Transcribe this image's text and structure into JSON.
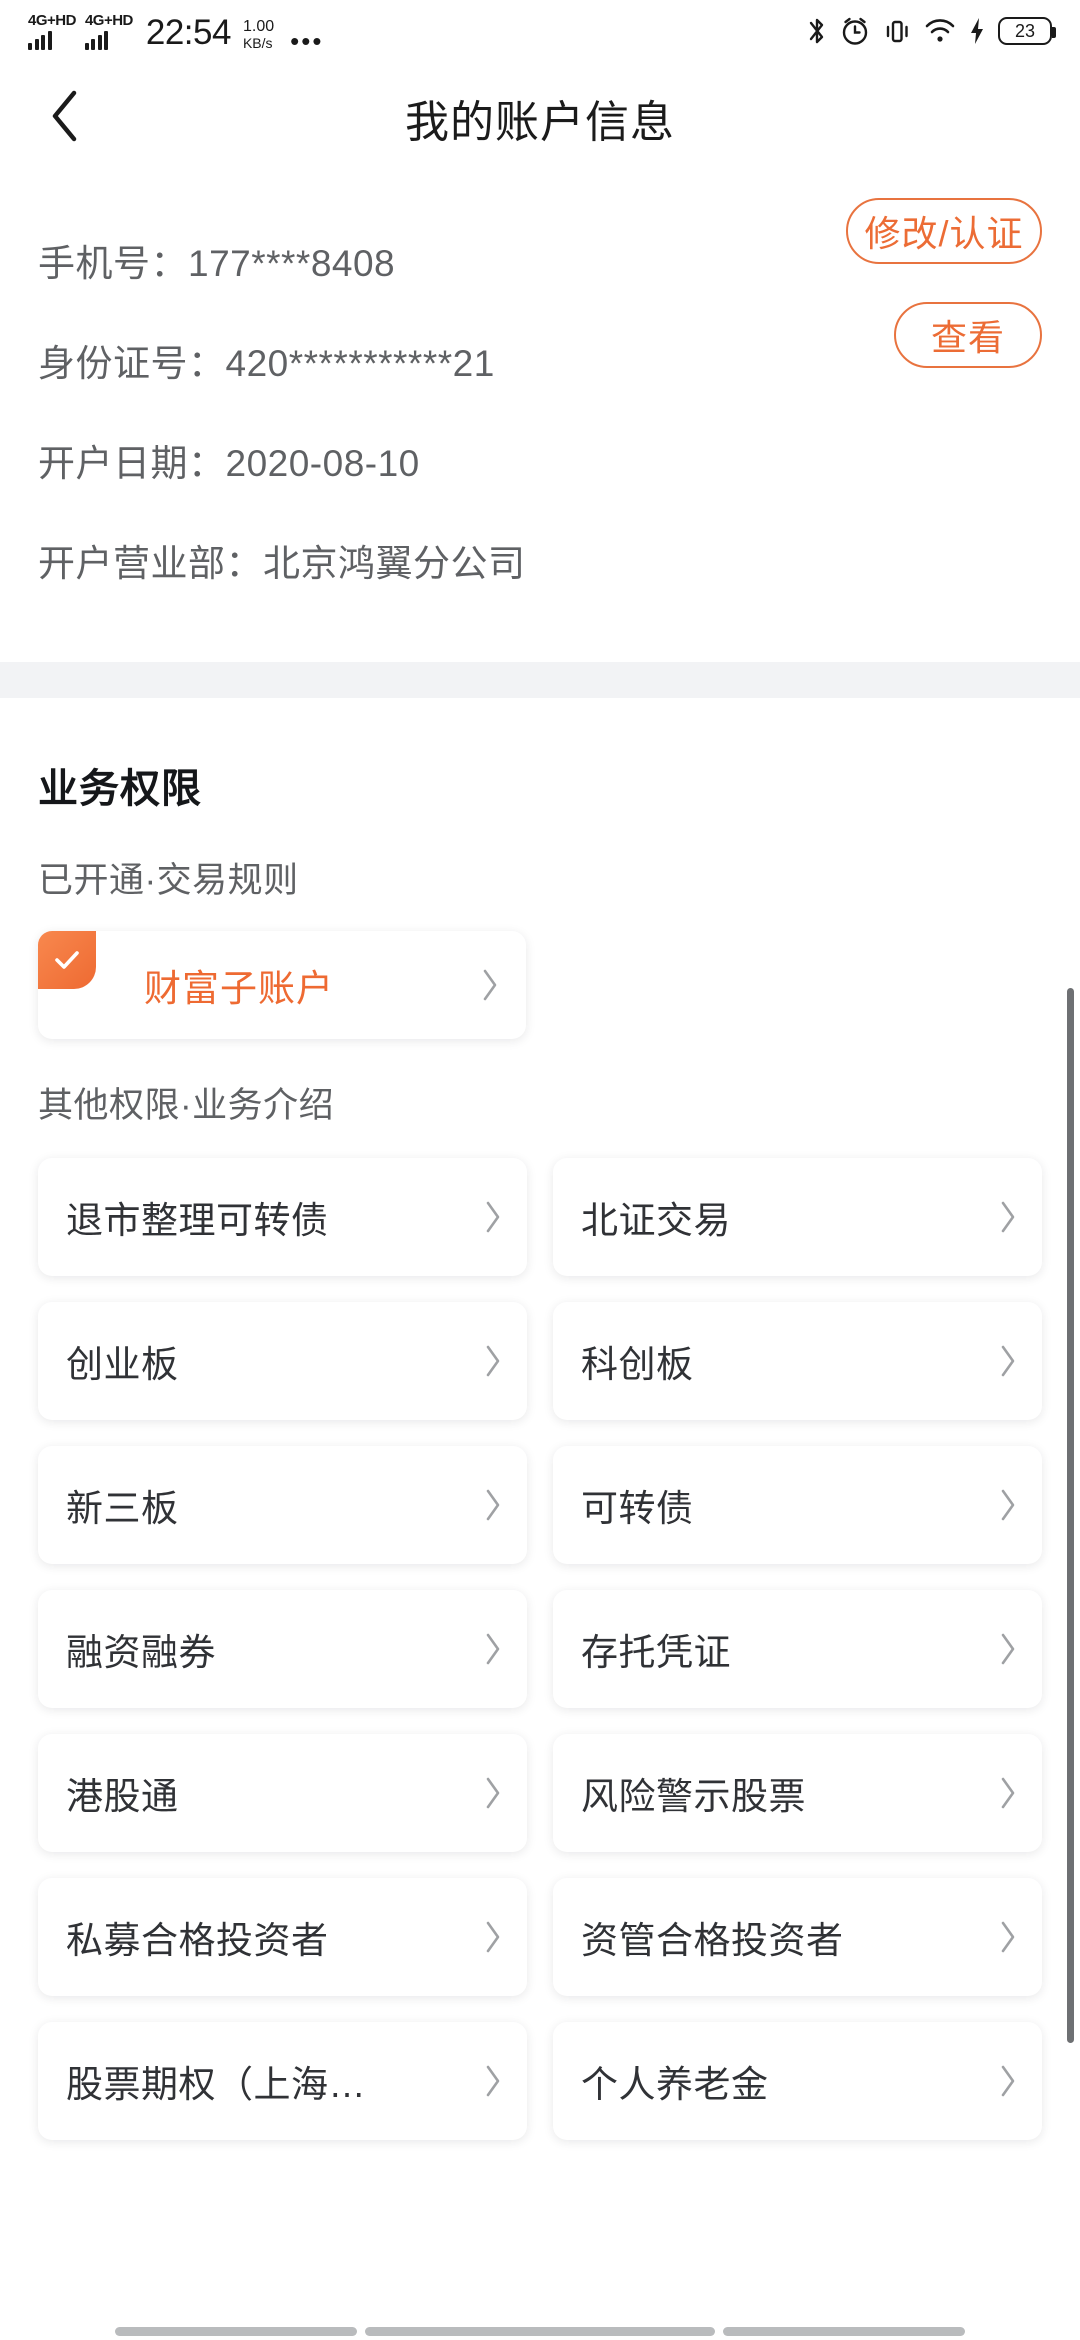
{
  "status_bar": {
    "network_label_1": "4G+HD",
    "network_label_2": "4G+HD",
    "time": "22:54",
    "speed_value": "1.00",
    "speed_unit": "KB/s",
    "more_dots": "•••",
    "battery_level": "23",
    "icons": [
      "bluetooth-icon",
      "alarm-icon",
      "vibrate-icon",
      "wifi-icon",
      "charging-bolt-icon",
      "battery-icon"
    ]
  },
  "nav": {
    "back_icon": "chevron-left-icon",
    "title": "我的账户信息"
  },
  "account_info": {
    "clipped_text": "· · · · · · · · · ·",
    "rows": [
      {
        "text": "手机号：177****8408",
        "action": "修改/认证"
      },
      {
        "text": "身份证号：420***********21",
        "action": "查看"
      },
      {
        "text": "开户日期：2020-08-10",
        "action": ""
      },
      {
        "text": "开户营业部：北京鸿翼分公司",
        "action": ""
      }
    ]
  },
  "permissions": {
    "section_title": "业务权限",
    "opened_subtitle": "已开通·交易规则",
    "opened_items": [
      {
        "label": "财富子账户",
        "checked": true
      }
    ],
    "other_subtitle": "其他权限·业务介绍",
    "other_items": [
      {
        "label": "退市整理可转债"
      },
      {
        "label": "北证交易"
      },
      {
        "label": "创业板"
      },
      {
        "label": "科创板"
      },
      {
        "label": "新三板"
      },
      {
        "label": "可转债"
      },
      {
        "label": "融资融券"
      },
      {
        "label": "存托凭证"
      },
      {
        "label": "港股通"
      },
      {
        "label": "风险警示股票"
      },
      {
        "label": "私募合格投资者"
      },
      {
        "label": "资管合格投资者"
      },
      {
        "label": "股票期权（上海…"
      },
      {
        "label": "个人养老金"
      }
    ]
  },
  "colors": {
    "accent_orange": "#ee6a32",
    "text_primary": "#303236",
    "text_secondary": "#5f6164",
    "page_bg": "#ffffff",
    "band_bg": "#f2f3f5"
  }
}
